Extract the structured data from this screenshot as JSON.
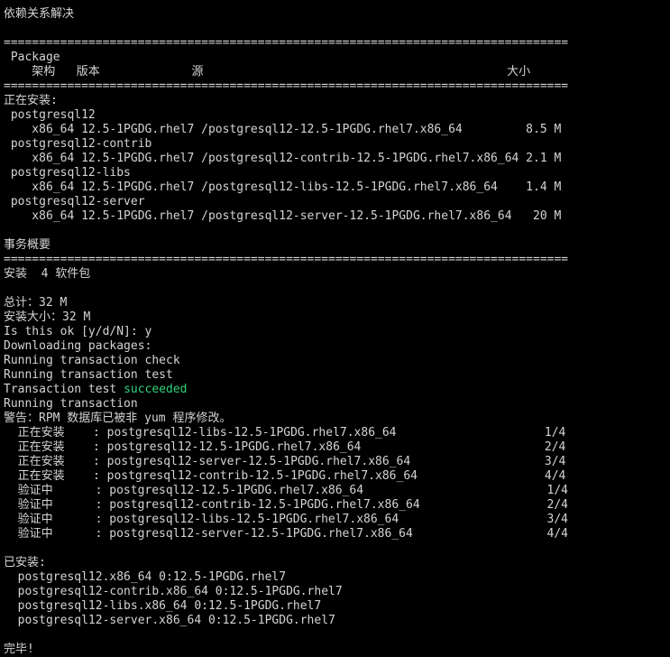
{
  "terminal": {
    "lines": [
      "依赖关系解决",
      "",
      "================================================================================",
      " Package",
      "    架构   版本             源                                           大小",
      "================================================================================",
      "正在安装:",
      " postgresql12",
      "    x86_64 12.5-1PGDG.rhel7 /postgresql12-12.5-1PGDG.rhel7.x86_64         8.5 M",
      " postgresql12-contrib",
      "    x86_64 12.5-1PGDG.rhel7 /postgresql12-contrib-12.5-1PGDG.rhel7.x86_64 2.1 M",
      " postgresql12-libs",
      "    x86_64 12.5-1PGDG.rhel7 /postgresql12-libs-12.5-1PGDG.rhel7.x86_64    1.4 M",
      " postgresql12-server",
      "    x86_64 12.5-1PGDG.rhel7 /postgresql12-server-12.5-1PGDG.rhel7.x86_64   20 M",
      "",
      "事务概要",
      "================================================================================",
      "安装  4 软件包",
      "",
      "总计：32 M",
      "安装大小：32 M",
      "Is this ok [y/d/N]: y",
      "Downloading packages:",
      "Running transaction check",
      "Running transaction test",
      "",
      "Running transaction",
      "警告：RPM 数据库已被非 yum 程序修改。",
      "  正在安装    : postgresql12-libs-12.5-1PGDG.rhel7.x86_64                     1/4",
      "  正在安装    : postgresql12-12.5-1PGDG.rhel7.x86_64                          2/4",
      "  正在安装    : postgresql12-server-12.5-1PGDG.rhel7.x86_64                   3/4",
      "  正在安装    : postgresql12-contrib-12.5-1PGDG.rhel7.x86_64                  4/4",
      "  验证中      : postgresql12-12.5-1PGDG.rhel7.x86_64                          1/4",
      "  验证中      : postgresql12-contrib-12.5-1PGDG.rhel7.x86_64                  2/4",
      "  验证中      : postgresql12-libs-12.5-1PGDG.rhel7.x86_64                     3/4",
      "  验证中      : postgresql12-server-12.5-1PGDG.rhel7.x86_64                   4/4",
      "",
      "已安装:",
      "  postgresql12.x86_64 0:12.5-1PGDG.rhel7",
      "  postgresql12-contrib.x86_64 0:12.5-1PGDG.rhel7",
      "  postgresql12-libs.x86_64 0:12.5-1PGDG.rhel7",
      "  postgresql12-server.x86_64 0:12.5-1PGDG.rhel7",
      "",
      "完毕!"
    ],
    "transaction_test_prefix": "Transaction test ",
    "transaction_test_status": "succeeded",
    "status_color": "#2fd17a"
  }
}
